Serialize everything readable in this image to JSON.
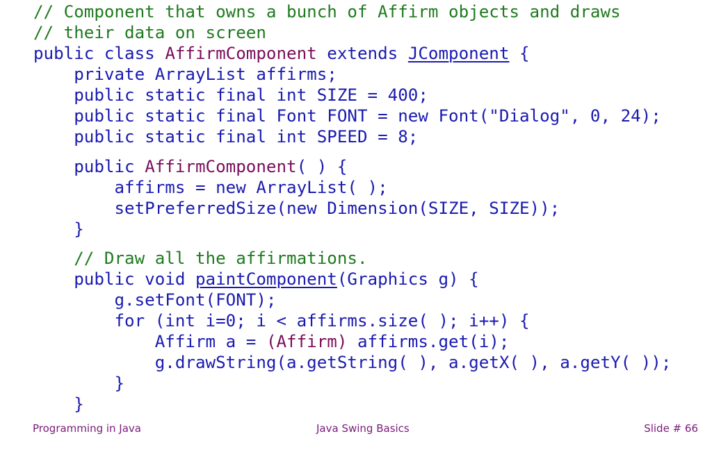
{
  "slide": {
    "code_lines": [
      {
        "indent": "",
        "parts": [
          {
            "t": "// Component that owns a bunch of Affirm objects and draws",
            "c": "cm"
          }
        ]
      },
      {
        "indent": "",
        "parts": [
          {
            "t": "// their data on screen",
            "c": "cm"
          }
        ]
      },
      {
        "indent": "",
        "parts": [
          {
            "t": "public class ",
            "c": "kw"
          },
          {
            "t": "AffirmComponent",
            "c": "cls"
          },
          {
            "t": " extends ",
            "c": "kw"
          },
          {
            "t": "JComponent",
            "c": "kw ul"
          },
          {
            "t": " {",
            "c": "kw"
          }
        ]
      },
      {
        "indent": "    ",
        "parts": [
          {
            "t": "private ArrayList affirms;",
            "c": "kw"
          }
        ]
      },
      {
        "indent": "    ",
        "parts": [
          {
            "t": "public static final int SIZE = 400;",
            "c": "kw"
          }
        ]
      },
      {
        "indent": "    ",
        "parts": [
          {
            "t": "public static final Font FONT = new Font(\"Dialog\", 0, 24);",
            "c": "kw"
          }
        ]
      },
      {
        "indent": "    ",
        "parts": [
          {
            "t": "public static final int SPEED = 8;",
            "c": "kw"
          }
        ]
      },
      {
        "gap": true
      },
      {
        "indent": "    ",
        "parts": [
          {
            "t": "public ",
            "c": "kw"
          },
          {
            "t": "AffirmComponent",
            "c": "cls"
          },
          {
            "t": "( ) {",
            "c": "kw"
          }
        ]
      },
      {
        "indent": "        ",
        "parts": [
          {
            "t": "affirms = new ArrayList( );",
            "c": "kw"
          }
        ]
      },
      {
        "indent": "        ",
        "parts": [
          {
            "t": "setPreferredSize(new Dimension(SIZE, SIZE));",
            "c": "kw"
          }
        ]
      },
      {
        "indent": "    ",
        "parts": [
          {
            "t": "}",
            "c": "kw"
          }
        ]
      },
      {
        "gap": true
      },
      {
        "indent": "    ",
        "parts": [
          {
            "t": "// Draw all the affirmations.",
            "c": "cm"
          }
        ]
      },
      {
        "indent": "    ",
        "parts": [
          {
            "t": "public void ",
            "c": "kw"
          },
          {
            "t": "paintComponent",
            "c": "kw ul"
          },
          {
            "t": "(Graphics g) {",
            "c": "kw"
          }
        ]
      },
      {
        "indent": "        ",
        "parts": [
          {
            "t": "g.setFont(FONT);",
            "c": "kw"
          }
        ]
      },
      {
        "indent": "        ",
        "parts": [
          {
            "t": "for (int i=0; i < affirms.size( ); i++) {",
            "c": "kw"
          }
        ]
      },
      {
        "indent": "            ",
        "parts": [
          {
            "t": "Affirm a = ",
            "c": "kw"
          },
          {
            "t": "(Affirm)",
            "c": "cls"
          },
          {
            "t": " affirms.get(i);",
            "c": "kw"
          }
        ]
      },
      {
        "indent": "            ",
        "parts": [
          {
            "t": "g.drawString(a.getString( ), a.getX( ), a.getY( ));",
            "c": "kw"
          }
        ]
      },
      {
        "indent": "        ",
        "parts": [
          {
            "t": "}",
            "c": "kw"
          }
        ]
      },
      {
        "indent": "    ",
        "parts": [
          {
            "t": "}",
            "c": "kw"
          }
        ]
      }
    ],
    "colors": {
      "comment": "#1f7a1f",
      "keyword": "#1a1ab0",
      "class_name": "#7a0d5a",
      "footer": "#7a1a7a"
    }
  },
  "footer": {
    "left": "Programming in Java",
    "center": "Java Swing Basics",
    "right": "Slide # 66"
  }
}
